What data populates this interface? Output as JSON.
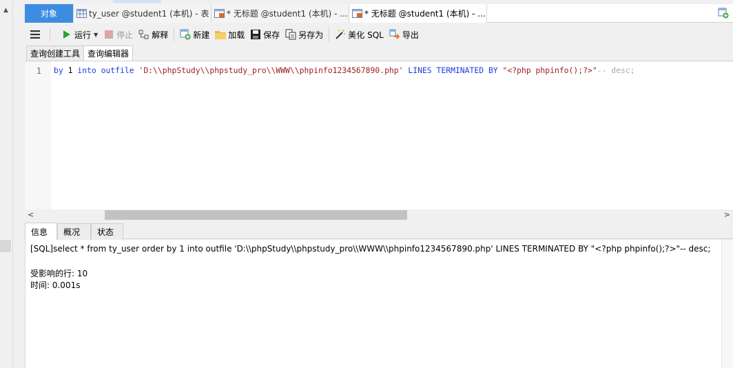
{
  "tabs": {
    "objects": "对象",
    "items": [
      {
        "label": "ty_user @student1 (本机) - 表"
      },
      {
        "label": "* 无标题 @student1 (本机) - ..."
      },
      {
        "label": "* 无标题 @student1 (本机) - ..."
      }
    ]
  },
  "toolbar": {
    "run": "运行",
    "stop": "停止",
    "explain": "解释",
    "new": "新建",
    "load": "加载",
    "save": "保存",
    "save_as": "另存为",
    "beautify": "美化 SQL",
    "export": "导出"
  },
  "subtabs": {
    "builder": "查询创建工具",
    "editor": "查询编辑器"
  },
  "editor": {
    "line_number": "1",
    "tokens": [
      {
        "text": "by ",
        "type": "kw"
      },
      {
        "text": "1 ",
        "type": "num"
      },
      {
        "text": "into ",
        "type": "kw"
      },
      {
        "text": "outfile ",
        "type": "kw"
      },
      {
        "text": "'D:\\\\phpStudy\\\\phpstudy_pro\\\\WWW\\\\phpinfo1234567890.php'",
        "type": "str"
      },
      {
        "text": " ",
        "type": "plain"
      },
      {
        "text": "LINES TERMINATED BY ",
        "type": "kw"
      },
      {
        "text": "\"<?php phpinfo();?>\"",
        "type": "str"
      },
      {
        "text": "-- desc;",
        "type": "cmt"
      }
    ]
  },
  "info_tabs": {
    "info": "信息",
    "overview": "概况",
    "status": "状态"
  },
  "messages": {
    "sql": "[SQL]select * from ty_user order by 1 into outfile 'D:\\\\phpStudy\\\\phpstudy_pro\\\\WWW\\\\phpinfo1234567890.php' LINES TERMINATED BY \"<?php phpinfo();?>\"-- desc;",
    "affected": "受影响的行: 10",
    "time": "时间: 0.001s"
  },
  "colors": {
    "active_tab": "#3c8de0",
    "keyword": "#1c3ce0",
    "string": "#a02020",
    "comment": "#a8a8a8"
  }
}
